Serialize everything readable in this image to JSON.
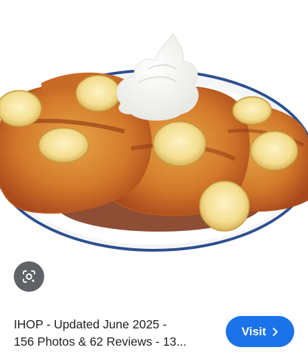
{
  "result": {
    "title_line1": "IHOP - Updated June 2025 -",
    "title_line2": "156 Photos & 62 Reviews - 13...",
    "visit_label": "Visit",
    "lens_icon": "google-lens-icon",
    "chevron_icon": "chevron-right-icon"
  },
  "colors": {
    "visit_button": "#1a73e8",
    "lens_button": "#5f6368",
    "text": "#202124"
  }
}
